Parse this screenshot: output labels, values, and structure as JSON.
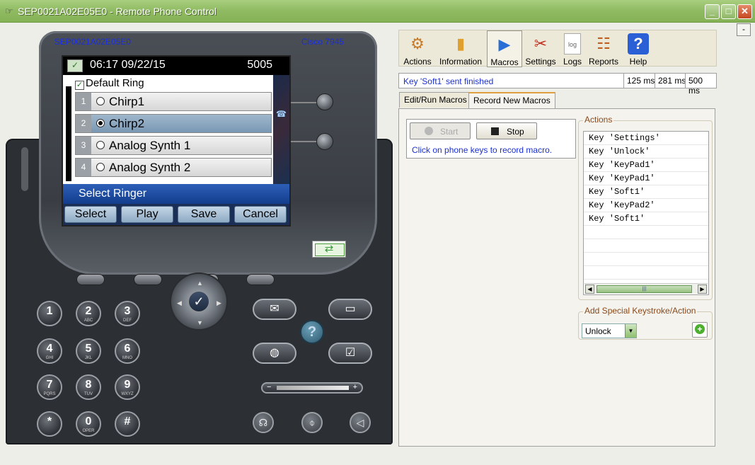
{
  "window": {
    "title": "SEP0021A02E05E0 - Remote Phone Control",
    "minimize": "_",
    "maximize": "□",
    "close": "✕",
    "mini_button": "-"
  },
  "phone": {
    "mac": "SEP0021A02E05E0",
    "model": "Cisco 7945",
    "screen": {
      "datetime": "06:17 09/22/15",
      "line": "5005",
      "list_header": "Default Ring",
      "items": [
        {
          "num": "1",
          "label": "Chirp1",
          "selected": false
        },
        {
          "num": "2",
          "label": "Chirp2",
          "selected": true
        },
        {
          "num": "3",
          "label": "Analog Synth 1",
          "selected": false
        },
        {
          "num": "4",
          "label": "Analog Synth 2",
          "selected": false
        }
      ],
      "prompt": "Select Ringer",
      "softkeys": [
        "Select",
        "Play",
        "Save",
        "Cancel"
      ]
    },
    "keypad": [
      {
        "d": "1",
        "l": ""
      },
      {
        "d": "2",
        "l": "ABC"
      },
      {
        "d": "3",
        "l": "DEF"
      },
      {
        "d": "4",
        "l": "GHI"
      },
      {
        "d": "5",
        "l": "JKL"
      },
      {
        "d": "6",
        "l": "MNO"
      },
      {
        "d": "7",
        "l": "PQRS"
      },
      {
        "d": "8",
        "l": "TUV"
      },
      {
        "d": "9",
        "l": "WXYZ"
      },
      {
        "d": "*",
        "l": ""
      },
      {
        "d": "0",
        "l": "OPER"
      },
      {
        "d": "#",
        "l": ""
      }
    ],
    "help_key": "?",
    "volume": {
      "minus": "−",
      "plus": "+"
    }
  },
  "toolbar": [
    {
      "label": "Actions",
      "icon": "gears-icon",
      "glyph": "⚙",
      "color": "#c77a2a"
    },
    {
      "label": "Information",
      "icon": "bar-chart-icon",
      "glyph": "▮",
      "color": "#e0a030"
    },
    {
      "label": "Macros",
      "icon": "play-icon",
      "glyph": "▶",
      "color": "#2a6fd6",
      "active": true
    },
    {
      "label": "Settings",
      "icon": "tools-icon",
      "glyph": "✂",
      "color": "#c03020"
    },
    {
      "label": "Logs",
      "icon": "log-file-icon",
      "glyph": "log",
      "color": "#666"
    },
    {
      "label": "Reports",
      "icon": "report-icon",
      "glyph": "☷",
      "color": "#c06020"
    },
    {
      "label": "Help",
      "icon": "help-icon",
      "glyph": "?",
      "color": "#2a5fd6"
    }
  ],
  "status": {
    "message": "Key 'Soft1' sent finished",
    "t1": "125 ms",
    "t2": "281 ms",
    "t3": "500 ms"
  },
  "tabs": [
    {
      "label": "Edit/Run Macros"
    },
    {
      "label": "Record New Macros",
      "active": true
    }
  ],
  "record": {
    "start": "Start",
    "stop": "Stop",
    "info": "Click on phone keys to record macro."
  },
  "actions": {
    "title": "Actions",
    "items": [
      "Key 'Settings'",
      "Key 'Unlock'",
      "Key 'KeyPad1'",
      "Key 'KeyPad1'",
      "Key 'Soft1'",
      "Key 'KeyPad2'",
      "Key 'Soft1'"
    ]
  },
  "special": {
    "title": "Add Special Keystroke/Action",
    "value": "Unlock"
  }
}
